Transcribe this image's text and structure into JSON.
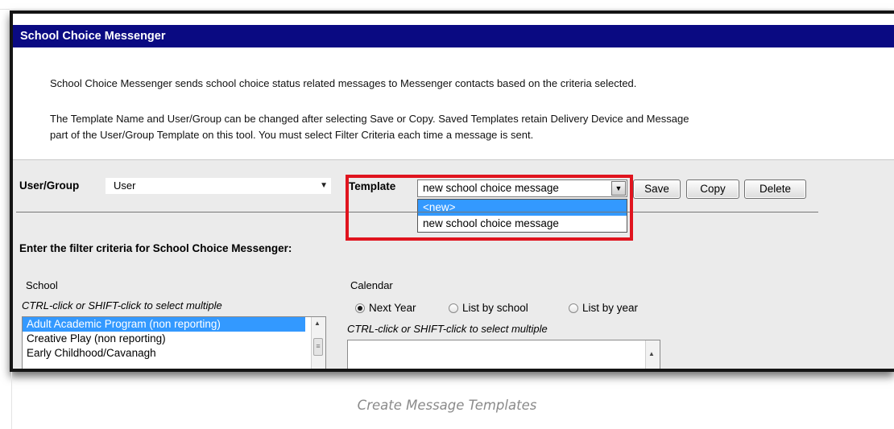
{
  "window": {
    "title": "School Choice Messenger"
  },
  "description": {
    "line1": "School Choice Messenger sends school choice status related messages to Messenger contacts based on the criteria selected.",
    "line2a": "The Template Name and User/Group can be changed after selecting Save or Copy. Saved Templates retain Delivery Device and Message",
    "line2b": "part of the User/Group Template on this tool. You must select Filter Criteria each time a message is sent."
  },
  "toolbar": {
    "user_group_label": "User/Group",
    "user_group_value": "User",
    "template_label": "Template",
    "template_value": "new school choice message",
    "template_options": [
      "<new>",
      "new school choice message"
    ],
    "save_label": "Save",
    "copy_label": "Copy",
    "delete_label": "Delete"
  },
  "filter": {
    "heading": "Enter the filter criteria for School Choice Messenger:",
    "school": {
      "label": "School",
      "hint": "CTRL-click or SHIFT-click to select multiple",
      "items": [
        "Adult Academic Program (non reporting)",
        "Creative Play (non reporting)",
        "Early Childhood/Cavanagh"
      ]
    },
    "calendar": {
      "label": "Calendar",
      "options": [
        "Next Year",
        "List by school",
        "List by year"
      ],
      "selected": "Next Year",
      "hint": "CTRL-click or SHIFT-click to select multiple"
    }
  },
  "caption": "Create Message Templates",
  "colors": {
    "title_bar": "#0a0a82",
    "highlight": "#e0141e",
    "selection": "#3399ff"
  }
}
